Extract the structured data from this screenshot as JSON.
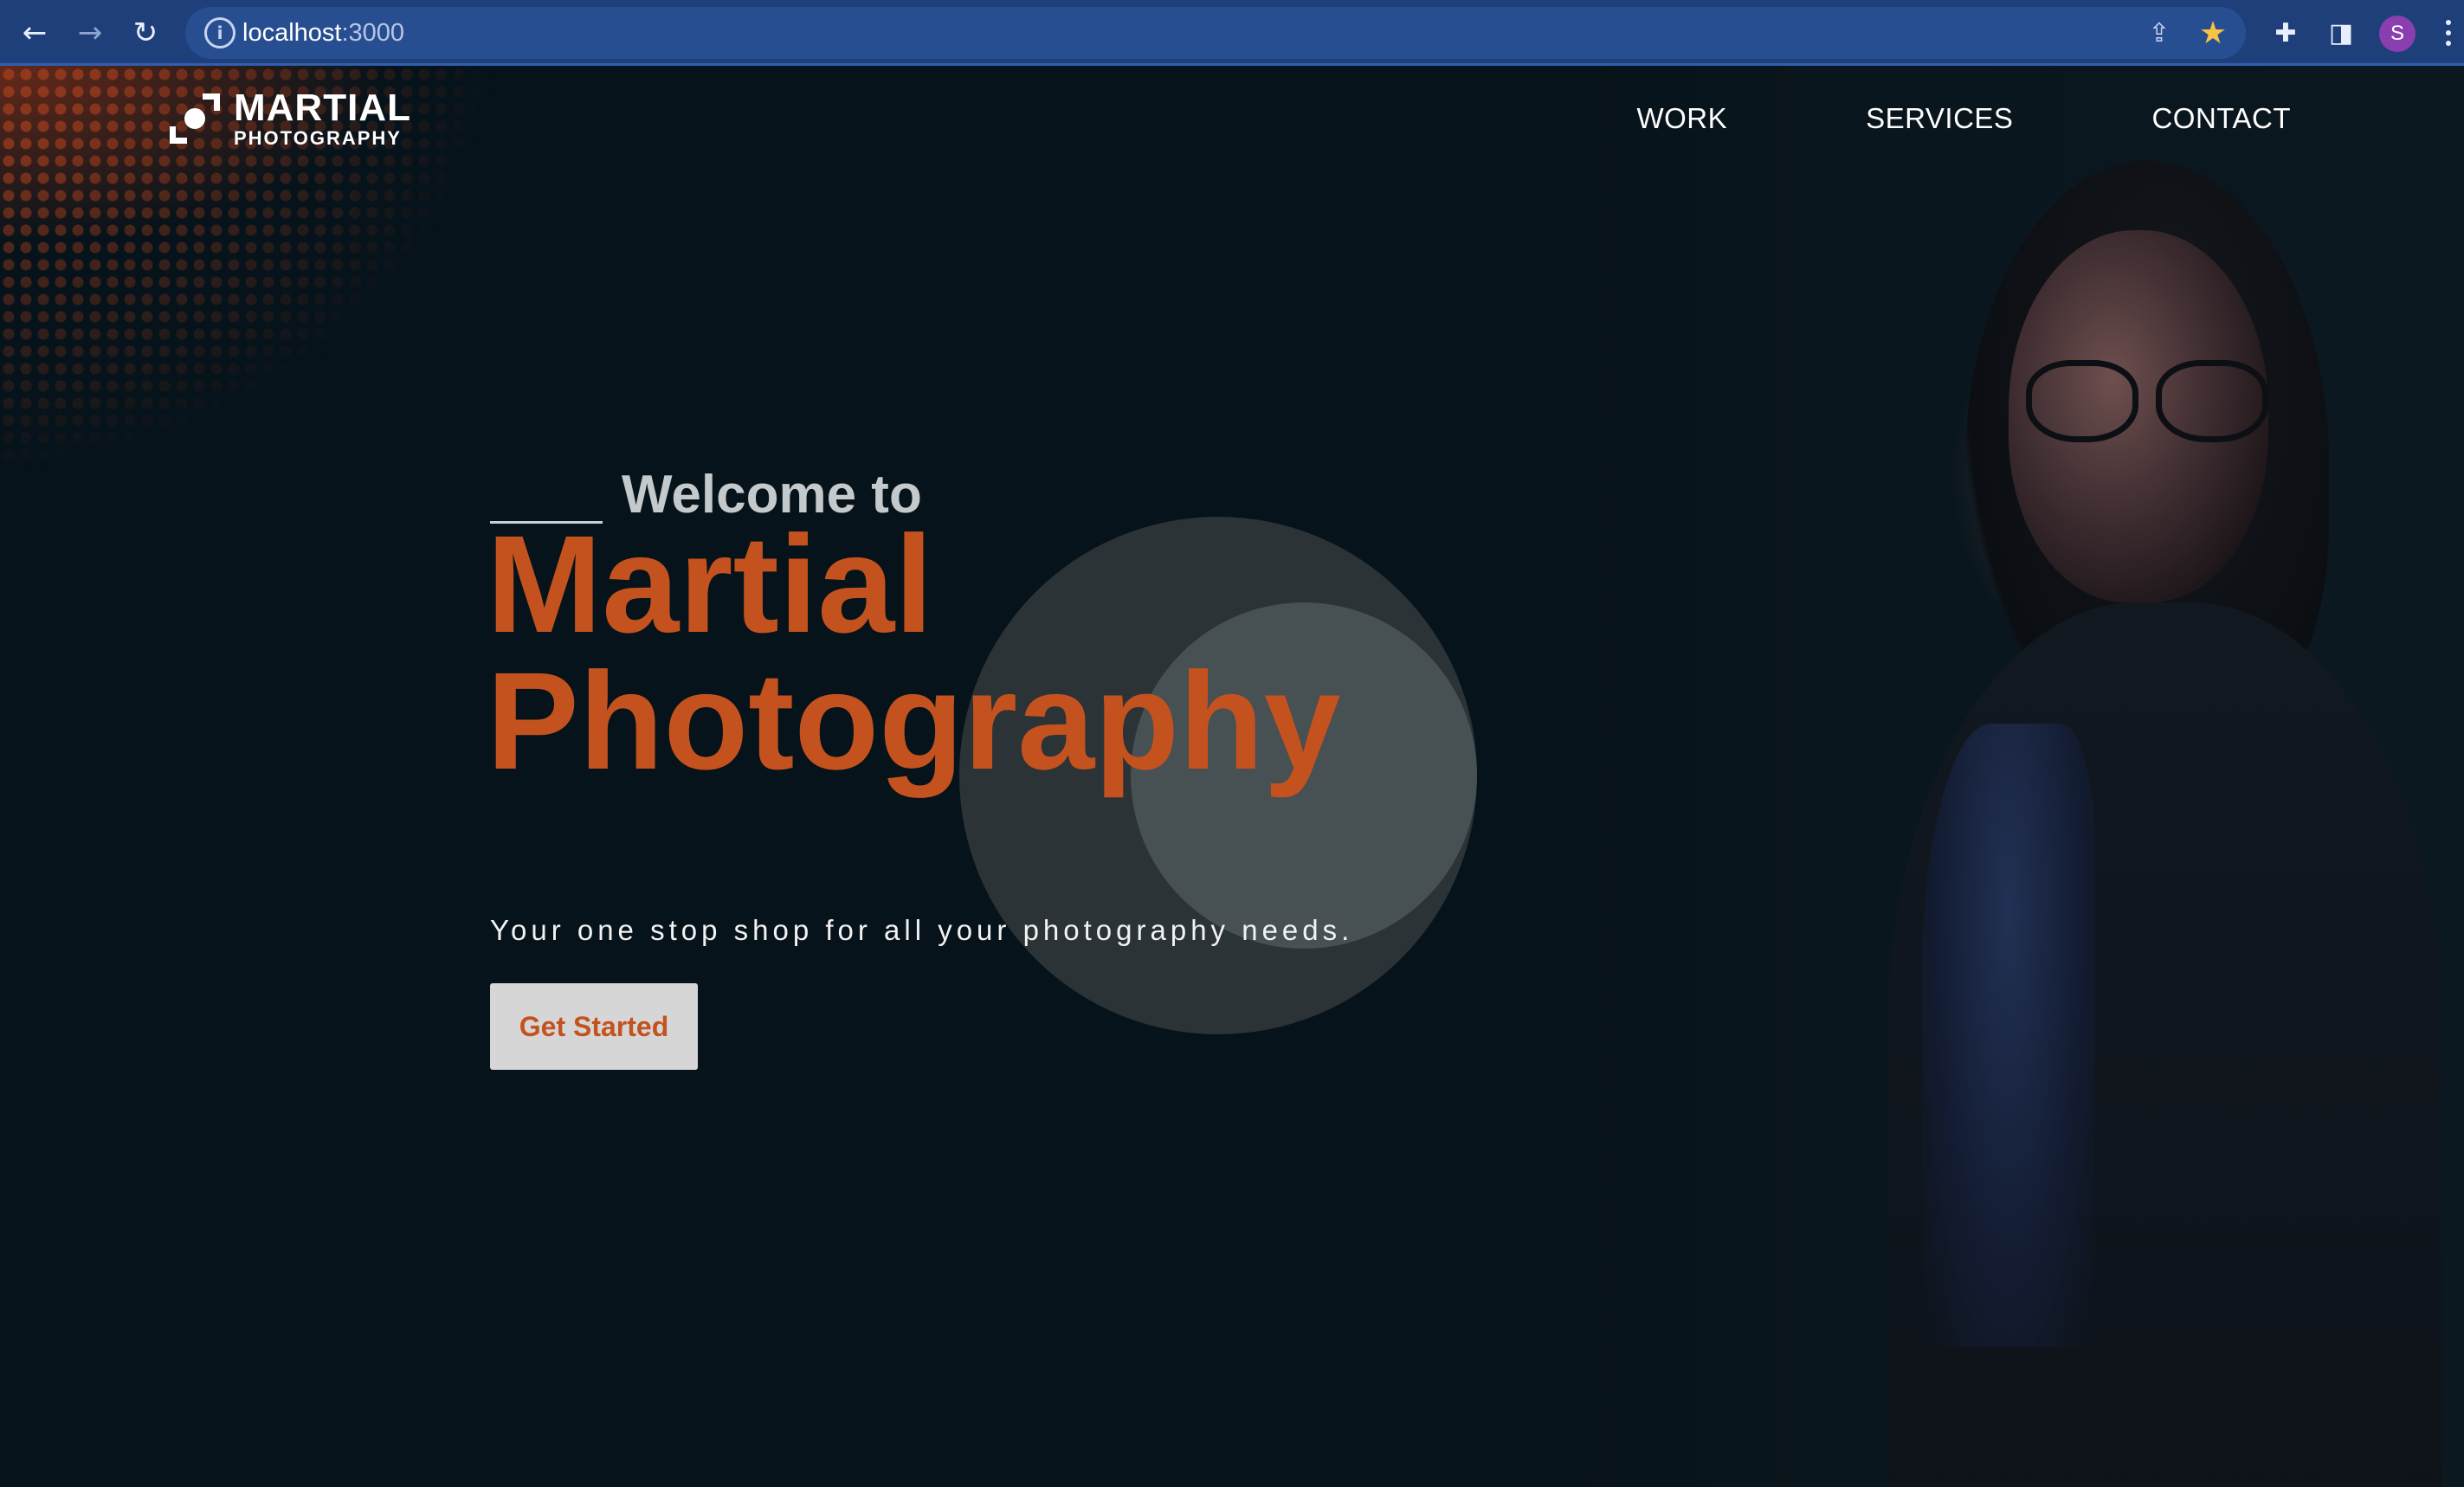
{
  "browser": {
    "back_icon": "←",
    "forward_icon": "→",
    "reload_icon": "↻",
    "info_icon": "i",
    "url_host": "localhost",
    "url_port": ":3000",
    "share_icon": "⇪",
    "star_icon": "★",
    "extensions_icon": "✚",
    "sidepanel_icon": "◨",
    "profile_initial": "S",
    "accent_color": "#1f3f7a"
  },
  "site": {
    "logo_title": "MARTIAL",
    "logo_subtitle": "PHOTOGRAPHY",
    "nav": [
      {
        "label": "WORK"
      },
      {
        "label": "SERVICES"
      },
      {
        "label": "CONTACT"
      }
    ],
    "hero": {
      "welcome": "Welcome to",
      "title_line1": "Martial",
      "title_line2": "Photography",
      "tagline": "Your one stop shop for all your photography needs.",
      "cta_label": "Get Started"
    },
    "colors": {
      "background": "#07131a",
      "accent": "#c4521f",
      "button_bg": "#d6d6d6"
    }
  }
}
